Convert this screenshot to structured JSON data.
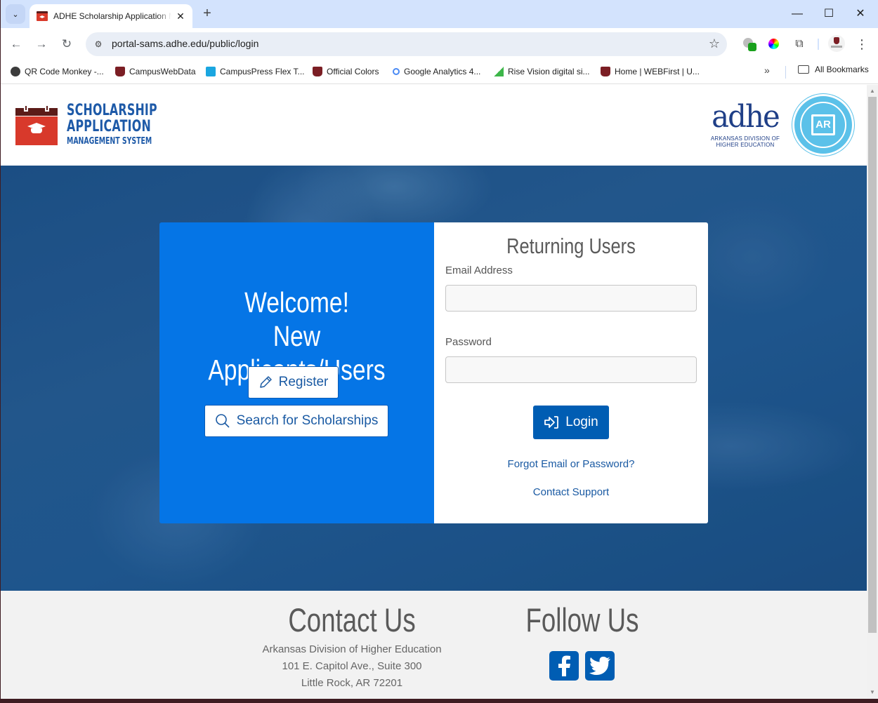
{
  "browser": {
    "tab_title": "ADHE Scholarship Application Management System",
    "url": "portal-sams.adhe.edu/public/login",
    "bookmarks": [
      {
        "label": "QR Code Monkey -...",
        "icon": "monkey-icon"
      },
      {
        "label": "CampusWebData",
        "icon": "ou-icon"
      },
      {
        "label": "CampusPress Flex T...",
        "icon": "campuspress-icon"
      },
      {
        "label": "Official Colors",
        "icon": "ou-icon"
      },
      {
        "label": "Google Analytics 4...",
        "icon": "analytics-icon"
      },
      {
        "label": "Rise Vision digital si...",
        "icon": "rise-vision-icon"
      },
      {
        "label": "Home | WEBFirst | U...",
        "icon": "ou-icon"
      }
    ],
    "more_bookmarks": "»",
    "all_bookmarks": "All Bookmarks",
    "icons": {
      "tab_search": "⌄",
      "close": "✕",
      "new_tab": "+",
      "minimize": "—",
      "maximize": "☐",
      "window_close": "✕",
      "back": "←",
      "forward": "→",
      "reload": "↻",
      "site_info": "⚙",
      "star": "☆",
      "puzzle": "⧉",
      "menu": "⋮"
    }
  },
  "header": {
    "logo_line1": "SCHOLARSHIP",
    "logo_line2": "APPLICATION",
    "logo_line3": "MANAGEMENT SYSTEM",
    "adhe_word": "adhe",
    "adhe_sub1": "ARKANSAS DIVISION OF",
    "adhe_sub2": "HIGHER EDUCATION",
    "seal_text": "AR"
  },
  "welcome": {
    "line1": "Welcome!",
    "line2": "New Applicants/Users",
    "register_label": "Register",
    "search_label": "Search for Scholarships"
  },
  "login": {
    "title": "Returning Users",
    "email_label": "Email Address",
    "email_value": "",
    "password_label": "Password",
    "password_value": "",
    "login_label": "Login",
    "forgot_link": "Forgot Email or Password?",
    "support_link": "Contact Support"
  },
  "footer": {
    "contact_title": "Contact Us",
    "address_line1": "Arkansas Division of Higher Education",
    "address_line2": "101 E. Capitol Ave., Suite 300",
    "address_line3": "Little Rock, AR 72201",
    "follow_title": "Follow Us",
    "social": [
      "facebook",
      "twitter"
    ]
  },
  "colors": {
    "brand_blue": "#0575e6",
    "button_blue": "#005db3",
    "link_blue": "#1a5aa3",
    "logo_red": "#d8392b"
  }
}
